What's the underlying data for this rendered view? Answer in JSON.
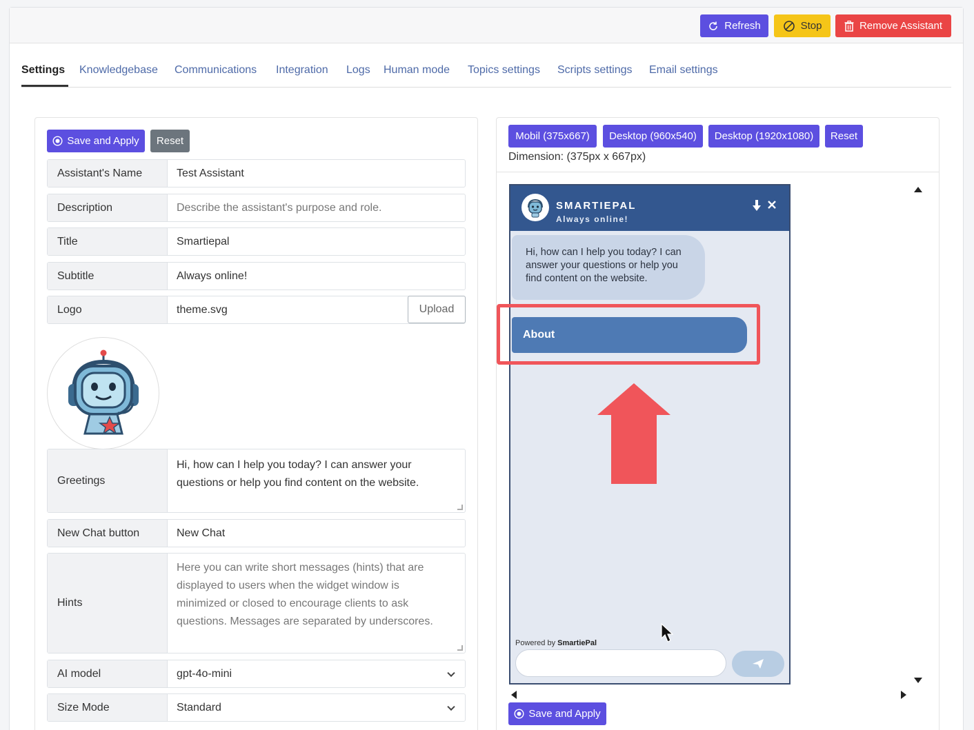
{
  "toolbar": {
    "refresh_label": "Refresh",
    "stop_label": "Stop",
    "remove_label": "Remove Assistant"
  },
  "tabs": [
    {
      "label": "Settings",
      "active": true
    },
    {
      "label": "Knowledgebase"
    },
    {
      "label": "Communications"
    },
    {
      "label": "Integration"
    },
    {
      "label": "Logs"
    },
    {
      "label": "Human mode"
    },
    {
      "label": "Topics settings"
    },
    {
      "label": "Scripts settings"
    },
    {
      "label": "Email settings"
    }
  ],
  "form": {
    "save_label": "Save and Apply",
    "reset_label": "Reset",
    "fields": {
      "name": {
        "label": "Assistant's Name",
        "value": "Test Assistant"
      },
      "description": {
        "label": "Description",
        "placeholder": "Describe the assistant's purpose and role."
      },
      "title": {
        "label": "Title",
        "value": "Smartiepal"
      },
      "subtitle": {
        "label": "Subtitle",
        "value": "Always online!"
      },
      "logo": {
        "label": "Logo",
        "value": "theme.svg",
        "upload_label": "Upload"
      },
      "greetings": {
        "label": "Greetings",
        "value": "Hi, how can I help you today? I can answer your questions or help you find content on the website."
      },
      "new_chat": {
        "label": "New Chat button",
        "value": "New Chat"
      },
      "hints": {
        "label": "Hints",
        "placeholder": "Here you can write short messages (hints) that are displayed to users when the widget window is minimized or closed to encourage clients to ask questions. Messages are separated by underscores."
      },
      "ai_model": {
        "label": "AI model",
        "value": "gpt-4o-mini"
      },
      "size_mode": {
        "label": "Size Mode",
        "value": "Standard"
      }
    }
  },
  "preview": {
    "sizes": [
      "Mobil (375x667)",
      "Desktop (960x540)",
      "Desktop (1920x1080)"
    ],
    "reset_label": "Reset",
    "dimension_text": "Dimension: (375px x 667px)",
    "save_label": "Save and Apply",
    "widget": {
      "title": "SMARTIEPAL",
      "subtitle": "Always online!",
      "greeting": "Hi, how can I help you today? I can answer your questions or help you find content on the website.",
      "option_label": "About",
      "powered_prefix": "Powered by ",
      "powered_brand": "SmartiePal"
    }
  },
  "colors": {
    "primary": "#5c4fe0",
    "warning": "#f5c518",
    "danger": "#ea4545",
    "widget_header": "#33578f",
    "widget_option": "#4e7ab4",
    "annotation": "#f0555a"
  }
}
